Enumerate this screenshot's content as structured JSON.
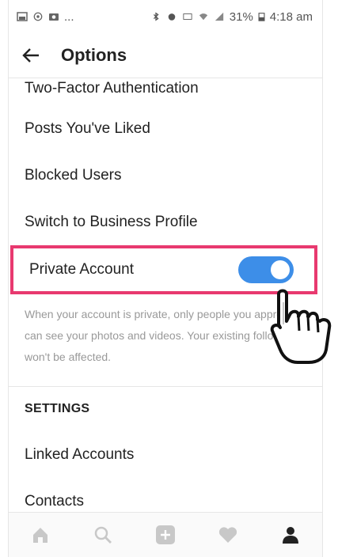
{
  "status_bar": {
    "dots": "...",
    "battery": "31%",
    "time": "4:18 am"
  },
  "header": {
    "title": "Options"
  },
  "menu": {
    "items": [
      "Two-Factor Authentication",
      "Posts You've Liked",
      "Blocked Users",
      "Switch to Business Profile"
    ],
    "private_account": {
      "label": "Private Account",
      "enabled": true,
      "description": "When your account is private, only people you approve can see your photos and videos. Your existing followers won't be affected."
    },
    "settings_header": "SETTINGS",
    "settings_items": [
      "Linked Accounts",
      "Contacts"
    ]
  },
  "bottom_nav": {
    "icons": [
      "home-icon",
      "search-icon",
      "add-icon",
      "heart-icon",
      "profile-icon"
    ]
  },
  "colors": {
    "toggle_on": "#3d8ee8",
    "highlight_border": "#e8396f"
  }
}
